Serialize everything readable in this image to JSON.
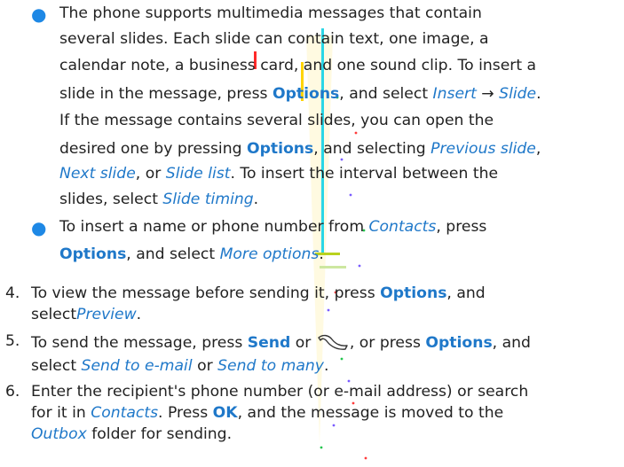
{
  "colors": {
    "accent": "#1f78c9",
    "bullet": "#1e88e5",
    "text": "#222222"
  },
  "bullet1": {
    "l1": "The phone supports multimedia messages that contain",
    "l2": "several slides. Each slide can contain text, one image, a",
    "l3": "calendar note, a business card, and one sound clip. To insert a",
    "l4a": "slide in the message, press ",
    "l4b": "Options",
    "l4c": ", and select ",
    "l4d": "Insert",
    "l4e": " → ",
    "l4f": "Slide",
    "l4g": ".",
    "l5": "If the message contains several slides, you can open the",
    "l6a": "desired one by pressing ",
    "l6b": "Options",
    "l6c": ", and selecting ",
    "l6d": "Previous slide",
    "l6e": ",",
    "l7a": "Next slide",
    "l7b": ", or ",
    "l7c": "Slide list",
    "l7d": ". To insert the interval between the",
    "l8a": "slides, select ",
    "l8b": "Slide timing",
    "l8c": "."
  },
  "bullet2": {
    "l1a": "To insert a name or phone number from ",
    "l1b": "Contacts",
    "l1c": ", press",
    "l2a": "Options",
    "l2b": ", and select ",
    "l2c": "More options",
    "l2d": "."
  },
  "step4": {
    "num": "4.",
    "l1a": "To view the message before sending it, press ",
    "l1b": "Options",
    "l1c": ", and",
    "l2a": "select",
    "l2b": "Preview",
    "l2c": "."
  },
  "step5": {
    "num": "5.",
    "l1a": "To send the message, press ",
    "l1b": "Send",
    "l1c": " or ",
    "l1d": ", or press ",
    "l1e": "Options",
    "l1f": ", and",
    "l2a": "select ",
    "l2b": "Send to e-mail",
    "l2c": " or ",
    "l2d": "Send to many",
    "l2e": "."
  },
  "step6": {
    "num": "6.",
    "l1": "Enter the recipient's phone number (or e-mail address) or search",
    "l2a": "for it in ",
    "l2b": "Contacts",
    "l2c": ". Press ",
    "l2d": "OK",
    "l2e": ", and the message is moved to the",
    "l3a": "Outbox",
    "l3b": " folder for sending."
  },
  "icons": {
    "send_key": "send-key-icon",
    "bullet": "bullet-icon",
    "watermark": "watermark"
  }
}
